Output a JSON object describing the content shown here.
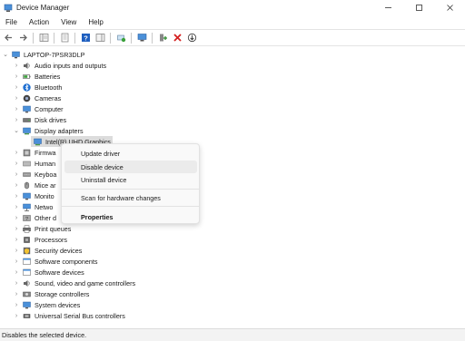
{
  "window": {
    "title": "Device Manager"
  },
  "menu": [
    "File",
    "Action",
    "View",
    "Help"
  ],
  "tree": {
    "root": "LAPTOP-7PSR3DLP",
    "categories": [
      "Audio inputs and outputs",
      "Batteries",
      "Bluetooth",
      "Cameras",
      "Computer",
      "Disk drives",
      "Display adapters",
      "Intel(R) UHD Graphics",
      "Firmwa",
      "Human",
      "Keyboa",
      "Mice ar",
      "Monito",
      "Netwo",
      "Other d",
      "Print queues",
      "Processors",
      "Security devices",
      "Software components",
      "Software devices",
      "Sound, video and game controllers",
      "Storage controllers",
      "System devices",
      "Universal Serial Bus controllers"
    ]
  },
  "context_menu": {
    "items": [
      "Update driver",
      "Disable device",
      "Uninstall device",
      "Scan for hardware changes",
      "Properties"
    ]
  },
  "status": {
    "text": "Disables the selected device."
  }
}
